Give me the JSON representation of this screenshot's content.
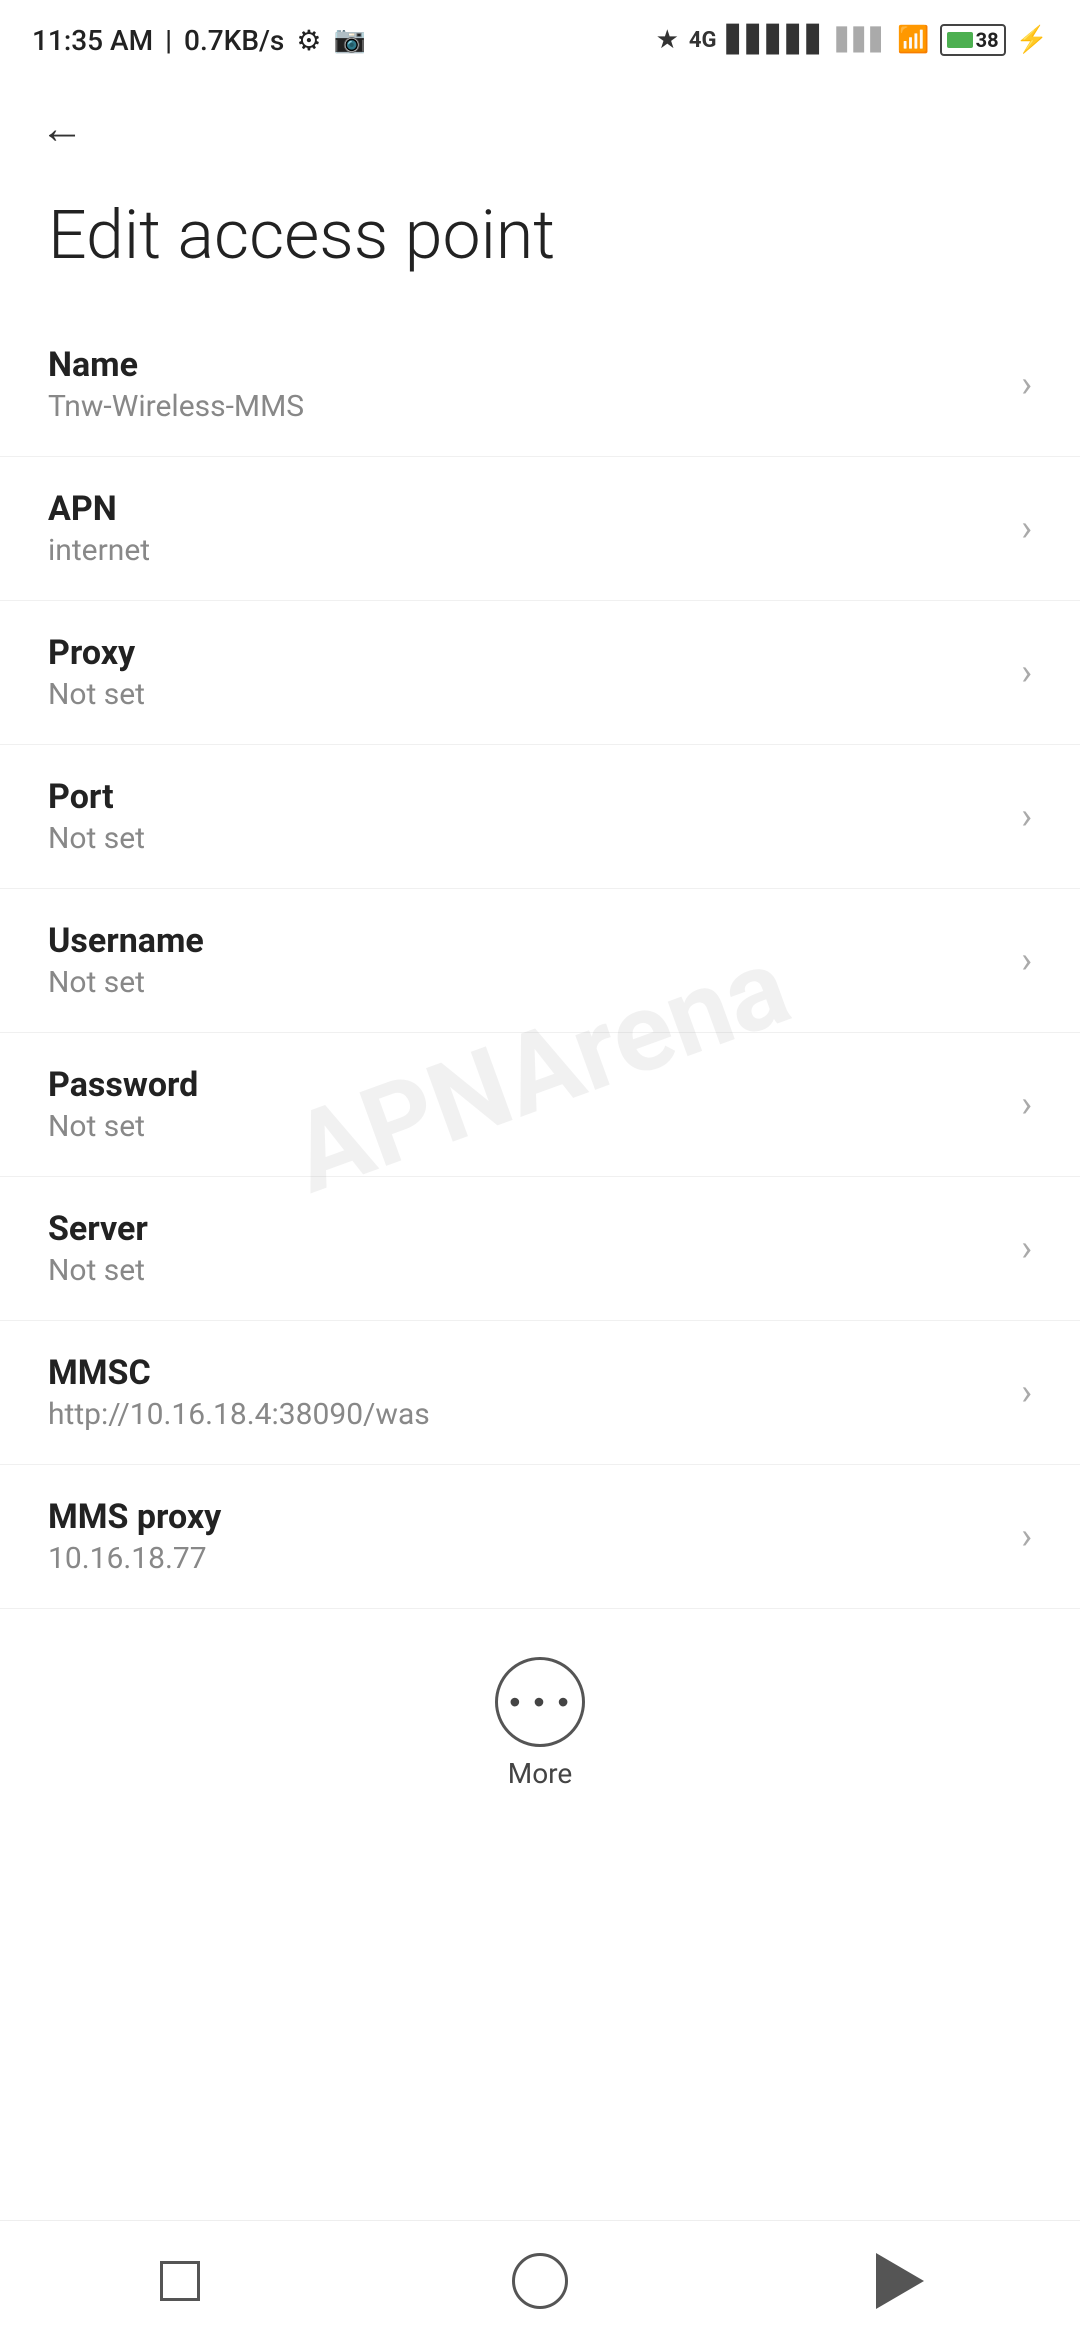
{
  "statusBar": {
    "time": "11:35 AM",
    "speed": "0.7KB/s",
    "battery": "38"
  },
  "nav": {
    "backLabel": "←"
  },
  "page": {
    "title": "Edit access point"
  },
  "fields": [
    {
      "label": "Name",
      "value": "Tnw-Wireless-MMS"
    },
    {
      "label": "APN",
      "value": "internet"
    },
    {
      "label": "Proxy",
      "value": "Not set"
    },
    {
      "label": "Port",
      "value": "Not set"
    },
    {
      "label": "Username",
      "value": "Not set"
    },
    {
      "label": "Password",
      "value": "Not set"
    },
    {
      "label": "Server",
      "value": "Not set"
    },
    {
      "label": "MMSC",
      "value": "http://10.16.18.4:38090/was"
    },
    {
      "label": "MMS proxy",
      "value": "10.16.18.77"
    }
  ],
  "more": {
    "label": "More"
  },
  "watermark": {
    "text": "APNArena"
  }
}
